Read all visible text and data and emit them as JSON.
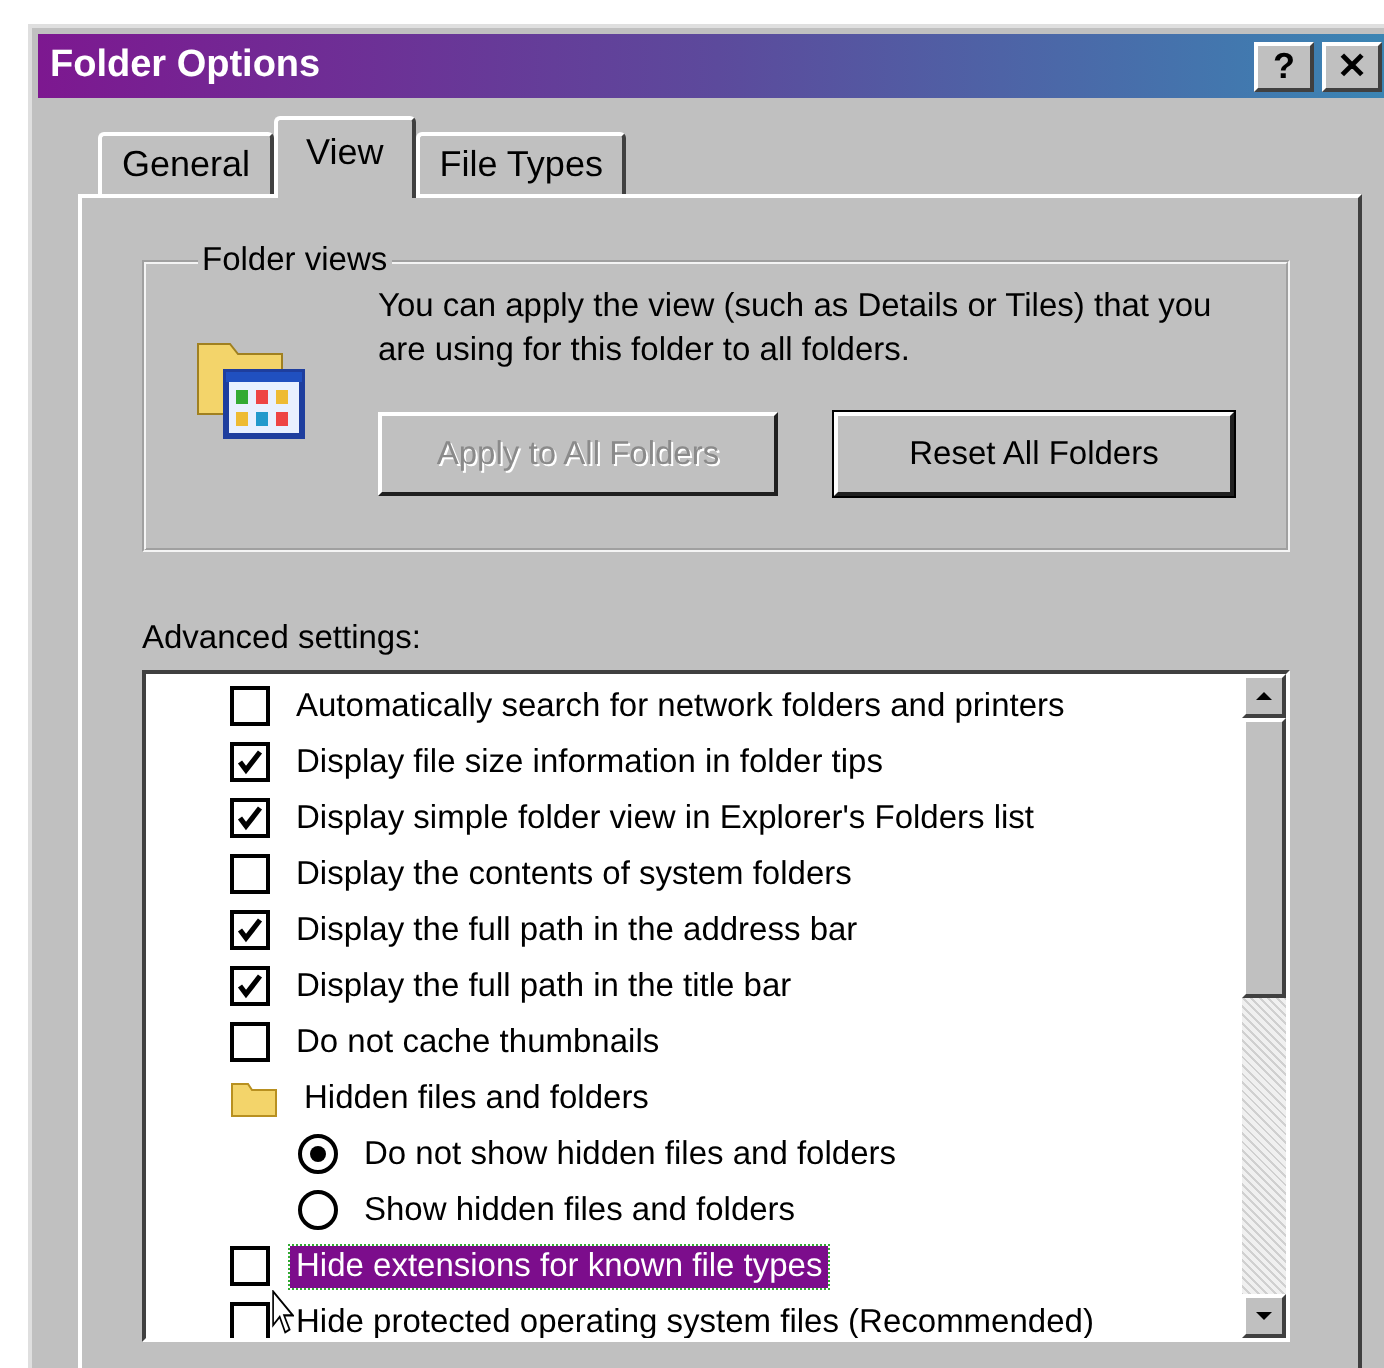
{
  "window": {
    "title": "Folder Options",
    "title_buttons": [
      "?",
      "✕"
    ]
  },
  "tabs": [
    {
      "label": "General",
      "selected": false
    },
    {
      "label": "View",
      "selected": true
    },
    {
      "label": "File Types",
      "selected": false
    }
  ],
  "folder_views": {
    "legend": "Folder views",
    "description": "You can apply the view (such as Details or Tiles) that you are using for this folder to all folders.",
    "buttons": [
      {
        "label": "Apply to All Folders",
        "disabled": true
      },
      {
        "label": "Reset All Folders",
        "disabled": false
      }
    ]
  },
  "advanced_settings": {
    "label": "Advanced settings:",
    "items": [
      {
        "kind": "checkbox",
        "label": "Automatically search for network folders and printers",
        "checked": false,
        "highlighted": false
      },
      {
        "kind": "checkbox",
        "label": "Display file size information in folder tips",
        "checked": true,
        "highlighted": false
      },
      {
        "kind": "checkbox",
        "label": "Display simple folder view in Explorer's Folders list",
        "checked": true,
        "highlighted": false
      },
      {
        "kind": "checkbox",
        "label": "Display the contents of system folders",
        "checked": false,
        "highlighted": false
      },
      {
        "kind": "checkbox",
        "label": "Display the full path in the address bar",
        "checked": true,
        "highlighted": false
      },
      {
        "kind": "checkbox",
        "label": "Display the full path in the title bar",
        "checked": true,
        "highlighted": false
      },
      {
        "kind": "checkbox",
        "label": "Do not cache thumbnails",
        "checked": false,
        "highlighted": false
      },
      {
        "kind": "group",
        "label": "Hidden files and folders",
        "highlighted": false
      },
      {
        "kind": "radio",
        "label": "Do not show hidden files and folders",
        "selected": true,
        "highlighted": false
      },
      {
        "kind": "radio",
        "label": "Show hidden files and folders",
        "selected": false,
        "highlighted": false
      },
      {
        "kind": "checkbox",
        "label": "Hide extensions for known file types",
        "checked": false,
        "highlighted": true
      },
      {
        "kind": "checkbox",
        "label": "Hide protected operating system files (Recommended)",
        "checked": false,
        "highlighted": false
      }
    ]
  }
}
